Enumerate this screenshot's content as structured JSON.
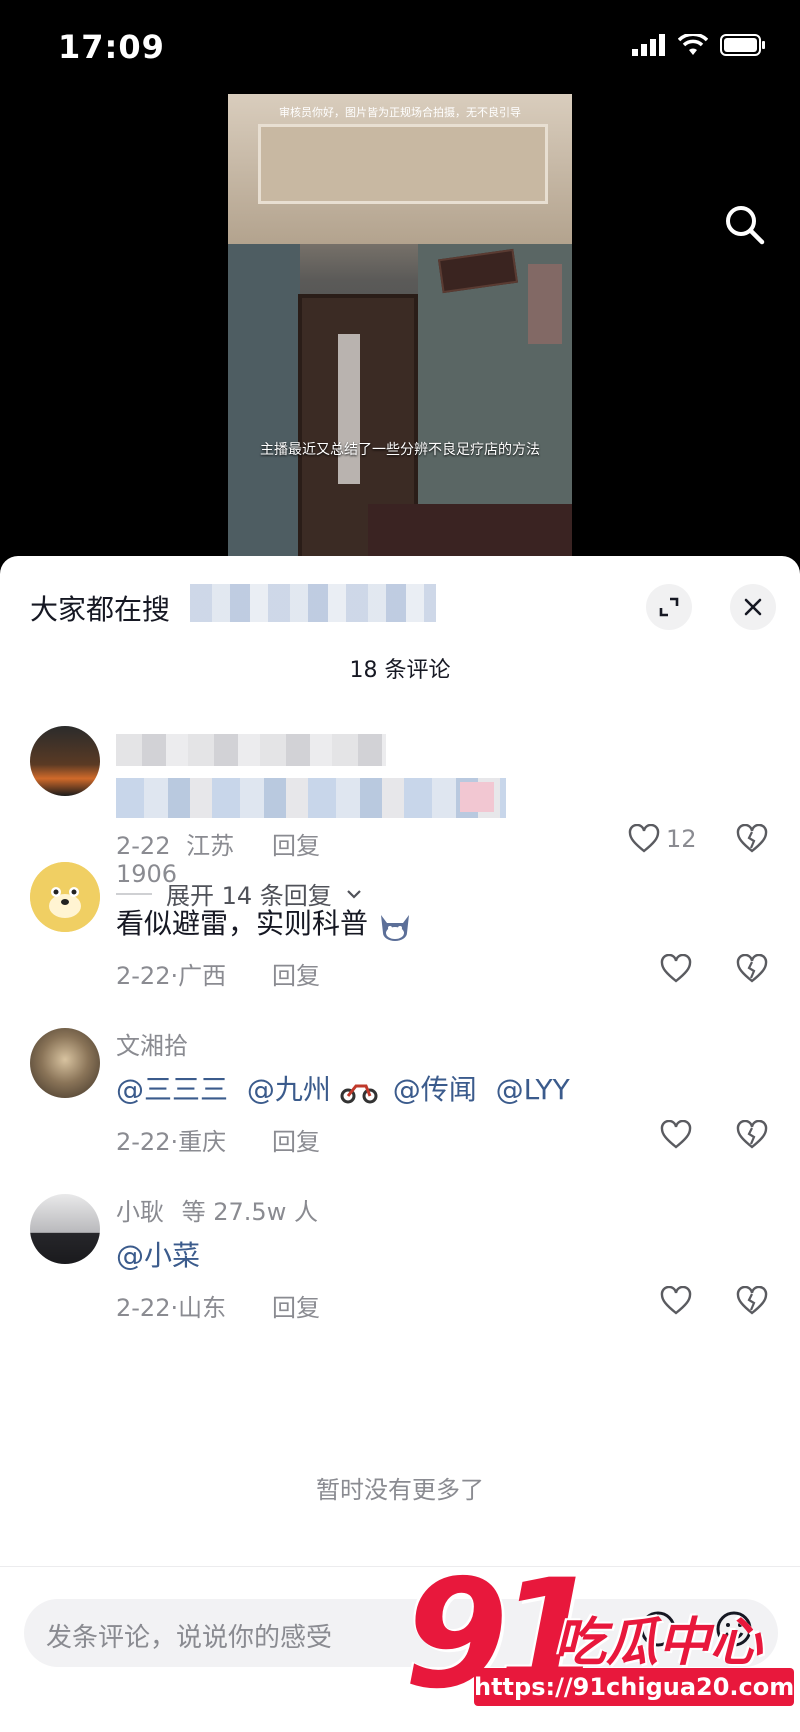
{
  "status_bar": {
    "time": "17:09"
  },
  "video": {
    "notice": "审核员你好，图片皆为正规场合拍摄，无不良引导",
    "caption": "主播最近又总结了一些分辨不良足疗店的方法"
  },
  "sheet": {
    "search_hint": "大家都在搜",
    "comment_count": "18 条评论",
    "comments": [
      {
        "name": "",
        "text": "",
        "date": "2-22",
        "location": "江苏",
        "reply": "回复",
        "likes": "12",
        "expand_replies": "展开 14 条回复"
      },
      {
        "name": "1906",
        "text": "看似避雷，实则科普",
        "date": "2-22",
        "location": "广西",
        "reply": "回复"
      },
      {
        "name": "文湘拾",
        "mentions": [
          "@三三三",
          "@九州",
          "@传闻",
          "@LYY"
        ],
        "date": "2-22",
        "location": "重庆",
        "reply": "回复"
      },
      {
        "name": "小耿",
        "name_suffix": "等 27.5w 人",
        "mentions": [
          "@小菜"
        ],
        "date": "2-22",
        "location": "山东",
        "reply": "回复"
      }
    ],
    "no_more": "暂时没有更多了",
    "input_placeholder": "发条评论，说说你的感受"
  },
  "watermark": {
    "number": "91",
    "text": "吃瓜中心",
    "url": "https://91chigua20.com"
  },
  "colors": {
    "accent": "#e8183c",
    "mention": "#3b5b8c",
    "secondary_text": "#8a8b91"
  }
}
